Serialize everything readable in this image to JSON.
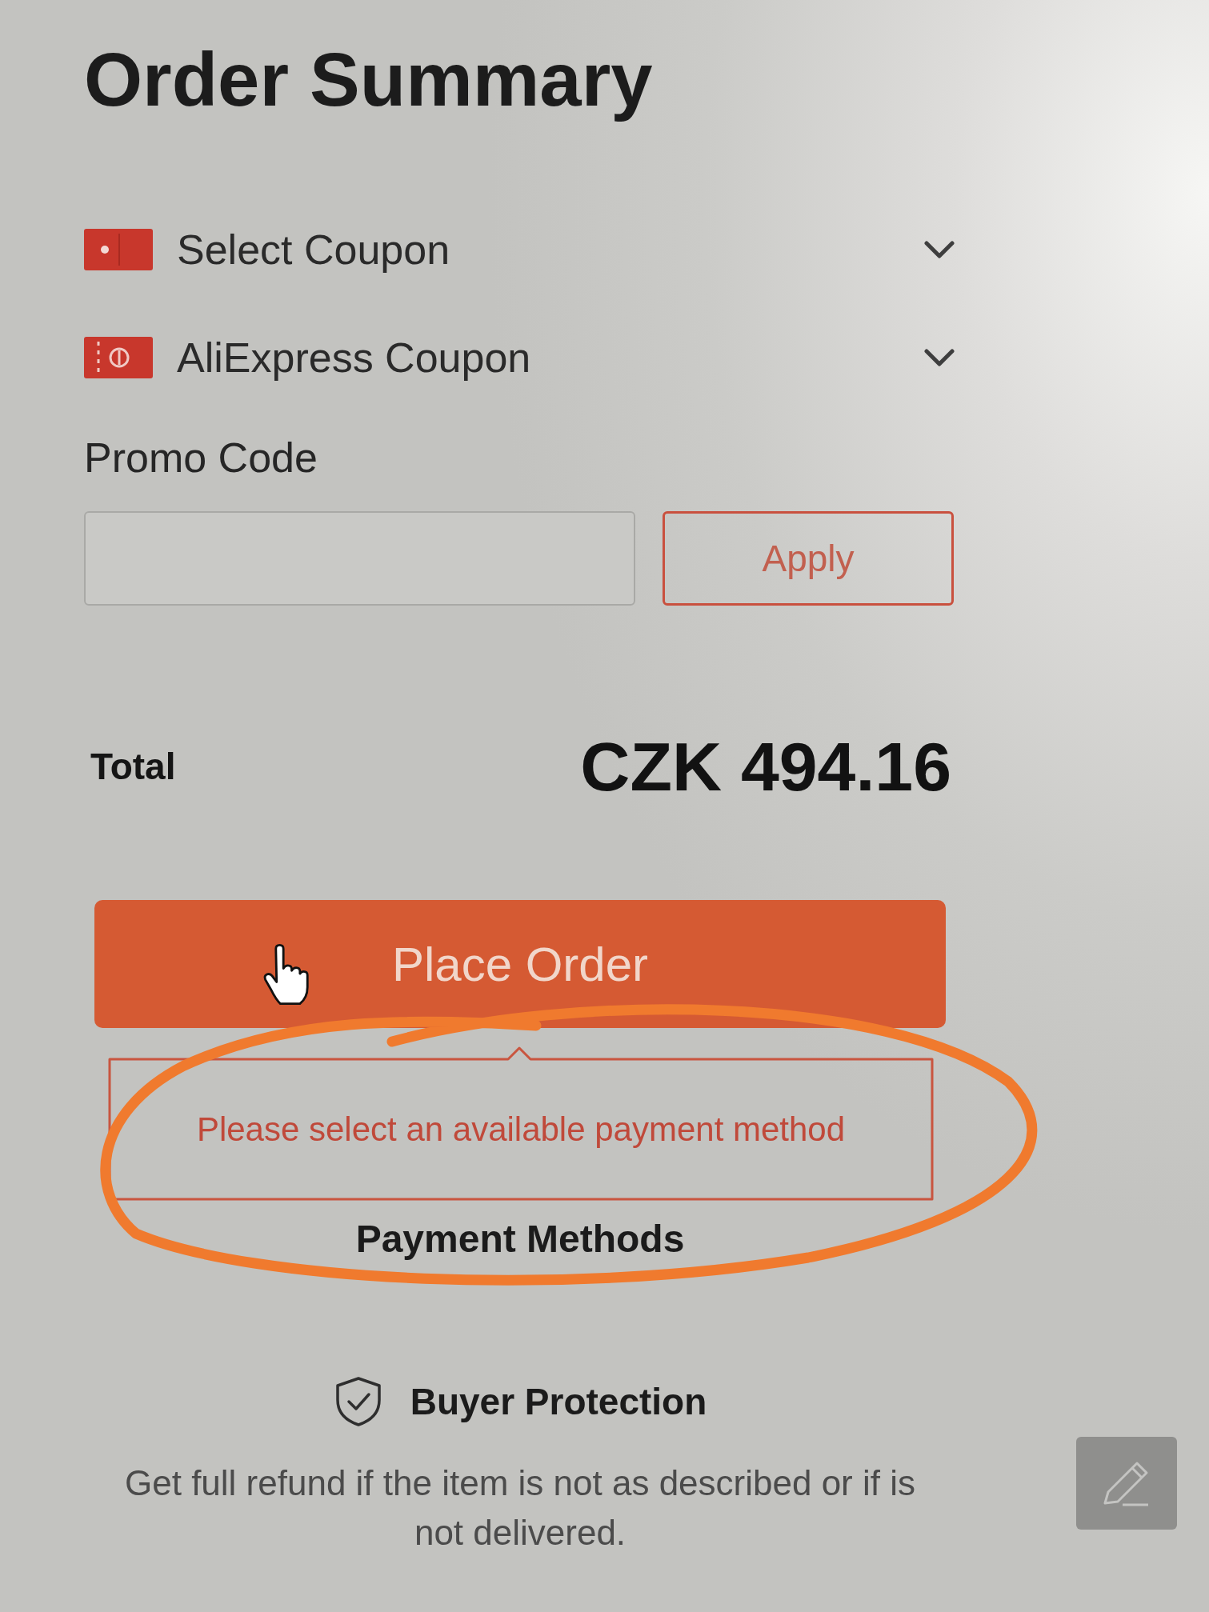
{
  "title": "Order Summary",
  "coupons": [
    {
      "kind": "seller",
      "label": "Select Coupon",
      "expanded": false
    },
    {
      "kind": "cash",
      "label": "AliExpress Coupon",
      "expanded": false
    }
  ],
  "promo_code": {
    "label": "Promo Code",
    "apply_button": "Apply"
  },
  "total": {
    "label": "Total",
    "amount": "CZK 494.16"
  },
  "place_order_button": "Place Order",
  "error_tooltip": "Please select an available payment method",
  "payment_methods_heading": "Payment Methods",
  "buyer_protection": {
    "title": "Buyer Protection",
    "description": "Get full refund if the item is not as described or if is not delivered."
  }
}
